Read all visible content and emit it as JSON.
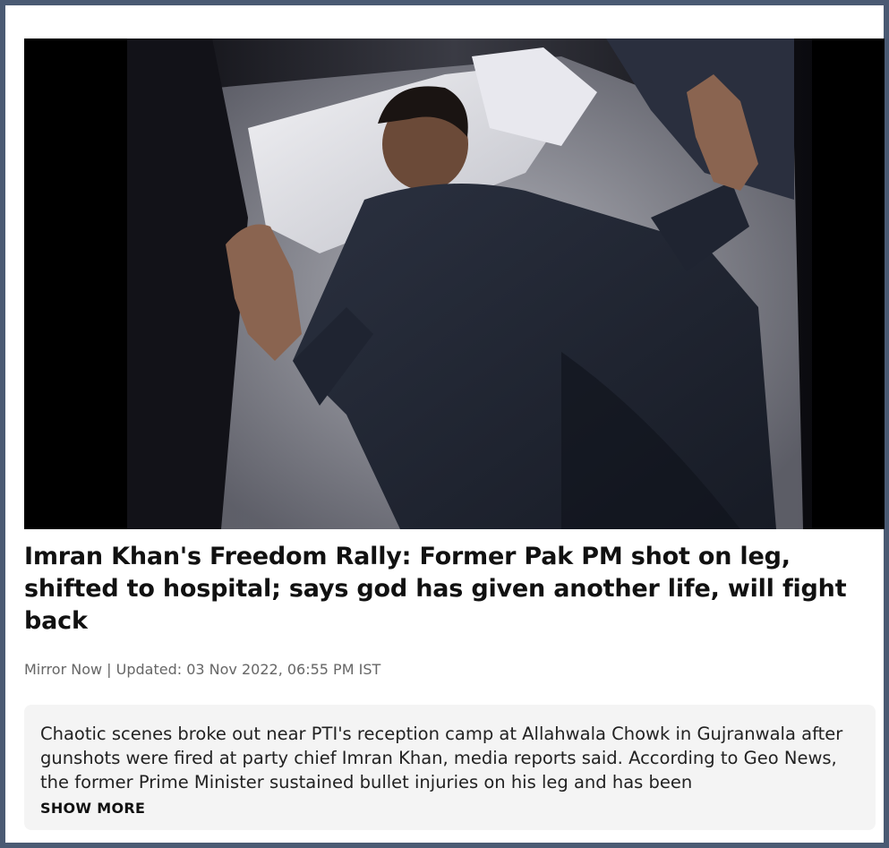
{
  "article": {
    "image_alt": "Imran Khan lying on a bed with raised hands",
    "headline": "Imran Khan's Freedom Rally: Former Pak PM shot on leg, shifted to hospital; says god has given another life, will fight back",
    "byline": "Mirror Now | Updated: 03 Nov 2022, 06:55 PM IST",
    "summary": "Chaotic scenes broke out near PTI's reception camp at Allahwala Chowk in Gujranwala after gunshots were fired at party chief Imran Khan, media reports said. According to Geo News, the former Prime Minister sustained bullet injuries on his leg and has been",
    "show_more_label": "SHOW MORE"
  },
  "colors": {
    "frame_border": "#4a5a73",
    "summary_background": "#f4f4f4",
    "headline": "#111111",
    "byline": "#666666"
  }
}
